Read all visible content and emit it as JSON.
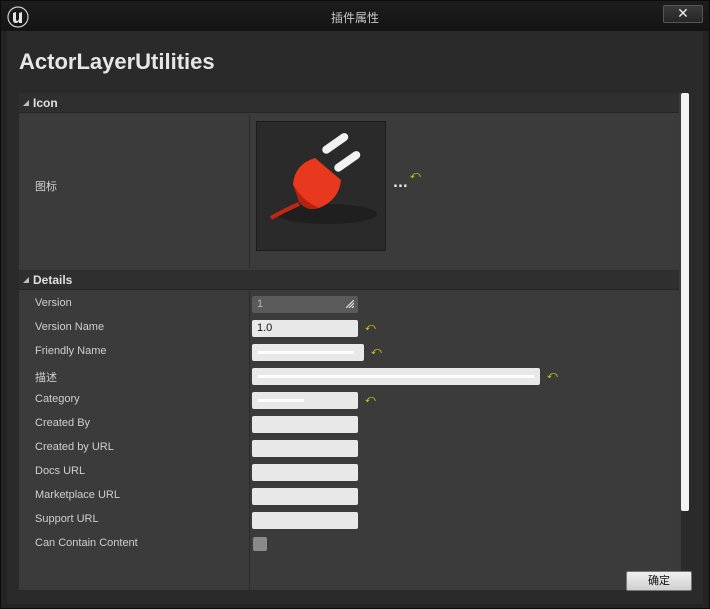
{
  "window": {
    "title": "插件属性",
    "close_glyph": "✕"
  },
  "plugin": {
    "name": "ActorLayerUtilities"
  },
  "icon_section": {
    "header": "Icon",
    "row_label": "图标",
    "browse_label": "..."
  },
  "details_section": {
    "header": "Details",
    "rows": [
      {
        "label": "Version",
        "value": "1"
      },
      {
        "label": "Version Name",
        "value": "1.0"
      },
      {
        "label": "Friendly Name",
        "value": ""
      },
      {
        "label": "描述",
        "value": ""
      },
      {
        "label": "Category",
        "value": ""
      },
      {
        "label": "Created By",
        "value": ""
      },
      {
        "label": "Created by URL",
        "value": ""
      },
      {
        "label": "Docs URL",
        "value": ""
      },
      {
        "label": "Marketplace URL",
        "value": ""
      },
      {
        "label": "Support URL",
        "value": ""
      },
      {
        "label": "Can Contain Content",
        "value": ""
      }
    ]
  },
  "footer": {
    "ok_label": "确定"
  },
  "colors": {
    "accent_reset": "#e8e800",
    "plug_red": "#e8381e"
  },
  "icons": {
    "logo": "unreal-engine-logo-icon",
    "reset": "reset-to-default-icon",
    "plug": "plugin-plug-icon"
  }
}
